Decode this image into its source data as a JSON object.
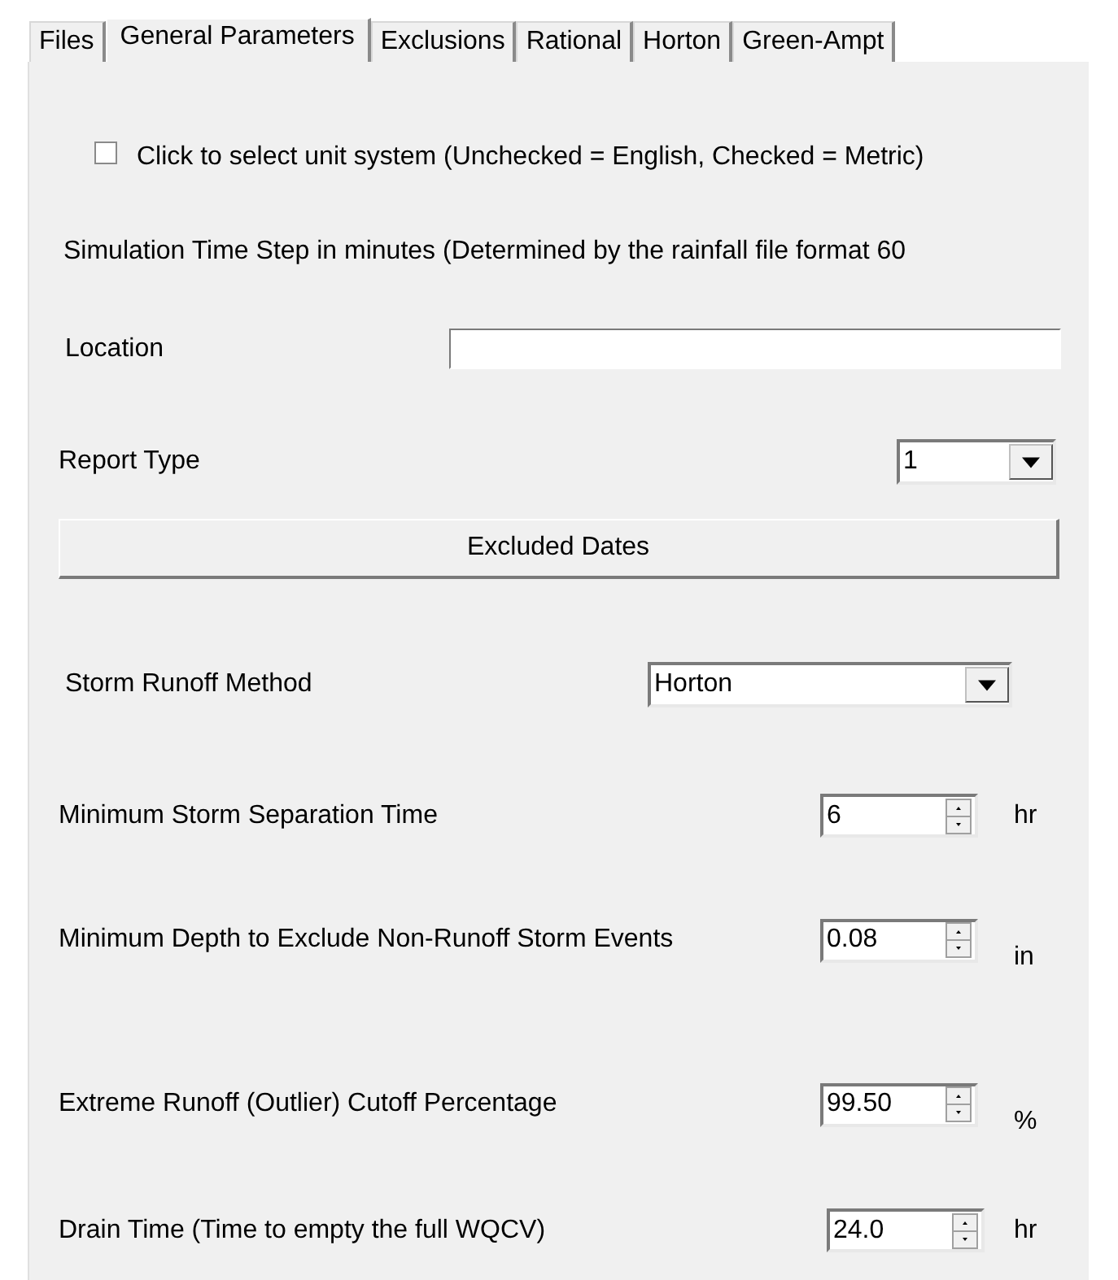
{
  "tabs": [
    {
      "label": "Files",
      "selected": false
    },
    {
      "label": "General Parameters",
      "selected": true
    },
    {
      "label": "Exclusions",
      "selected": false
    },
    {
      "label": "Rational",
      "selected": false
    },
    {
      "label": "Horton",
      "selected": false
    },
    {
      "label": "Green-Ampt",
      "selected": false
    }
  ],
  "unit_checkbox": {
    "label": "Click to select unit system (Unchecked = English, Checked = Metric)",
    "checked": false
  },
  "time_step_note": "Simulation Time Step in minutes (Determined by the rainfall file format 60",
  "location": {
    "label": "Location"
  },
  "report_type": {
    "label": "Report Type",
    "value": "1"
  },
  "excluded_dates_button": "Excluded Dates",
  "storm_runoff_method": {
    "label": "Storm Runoff Method",
    "value": "Horton"
  },
  "parameters": [
    {
      "label": "Minimum Storm Separation Time",
      "value": "6",
      "unit": "hr"
    },
    {
      "label": "Minimum Depth to Exclude Non-Runoff Storm Events",
      "value": "0.08",
      "unit": "in"
    },
    {
      "label": "Extreme Runoff (Outlier) Cutoff Percentage",
      "value": "99.50",
      "unit": "%"
    },
    {
      "label": "Drain Time (Time to empty the full WQCV)",
      "value": "24.0",
      "unit": "hr"
    }
  ]
}
